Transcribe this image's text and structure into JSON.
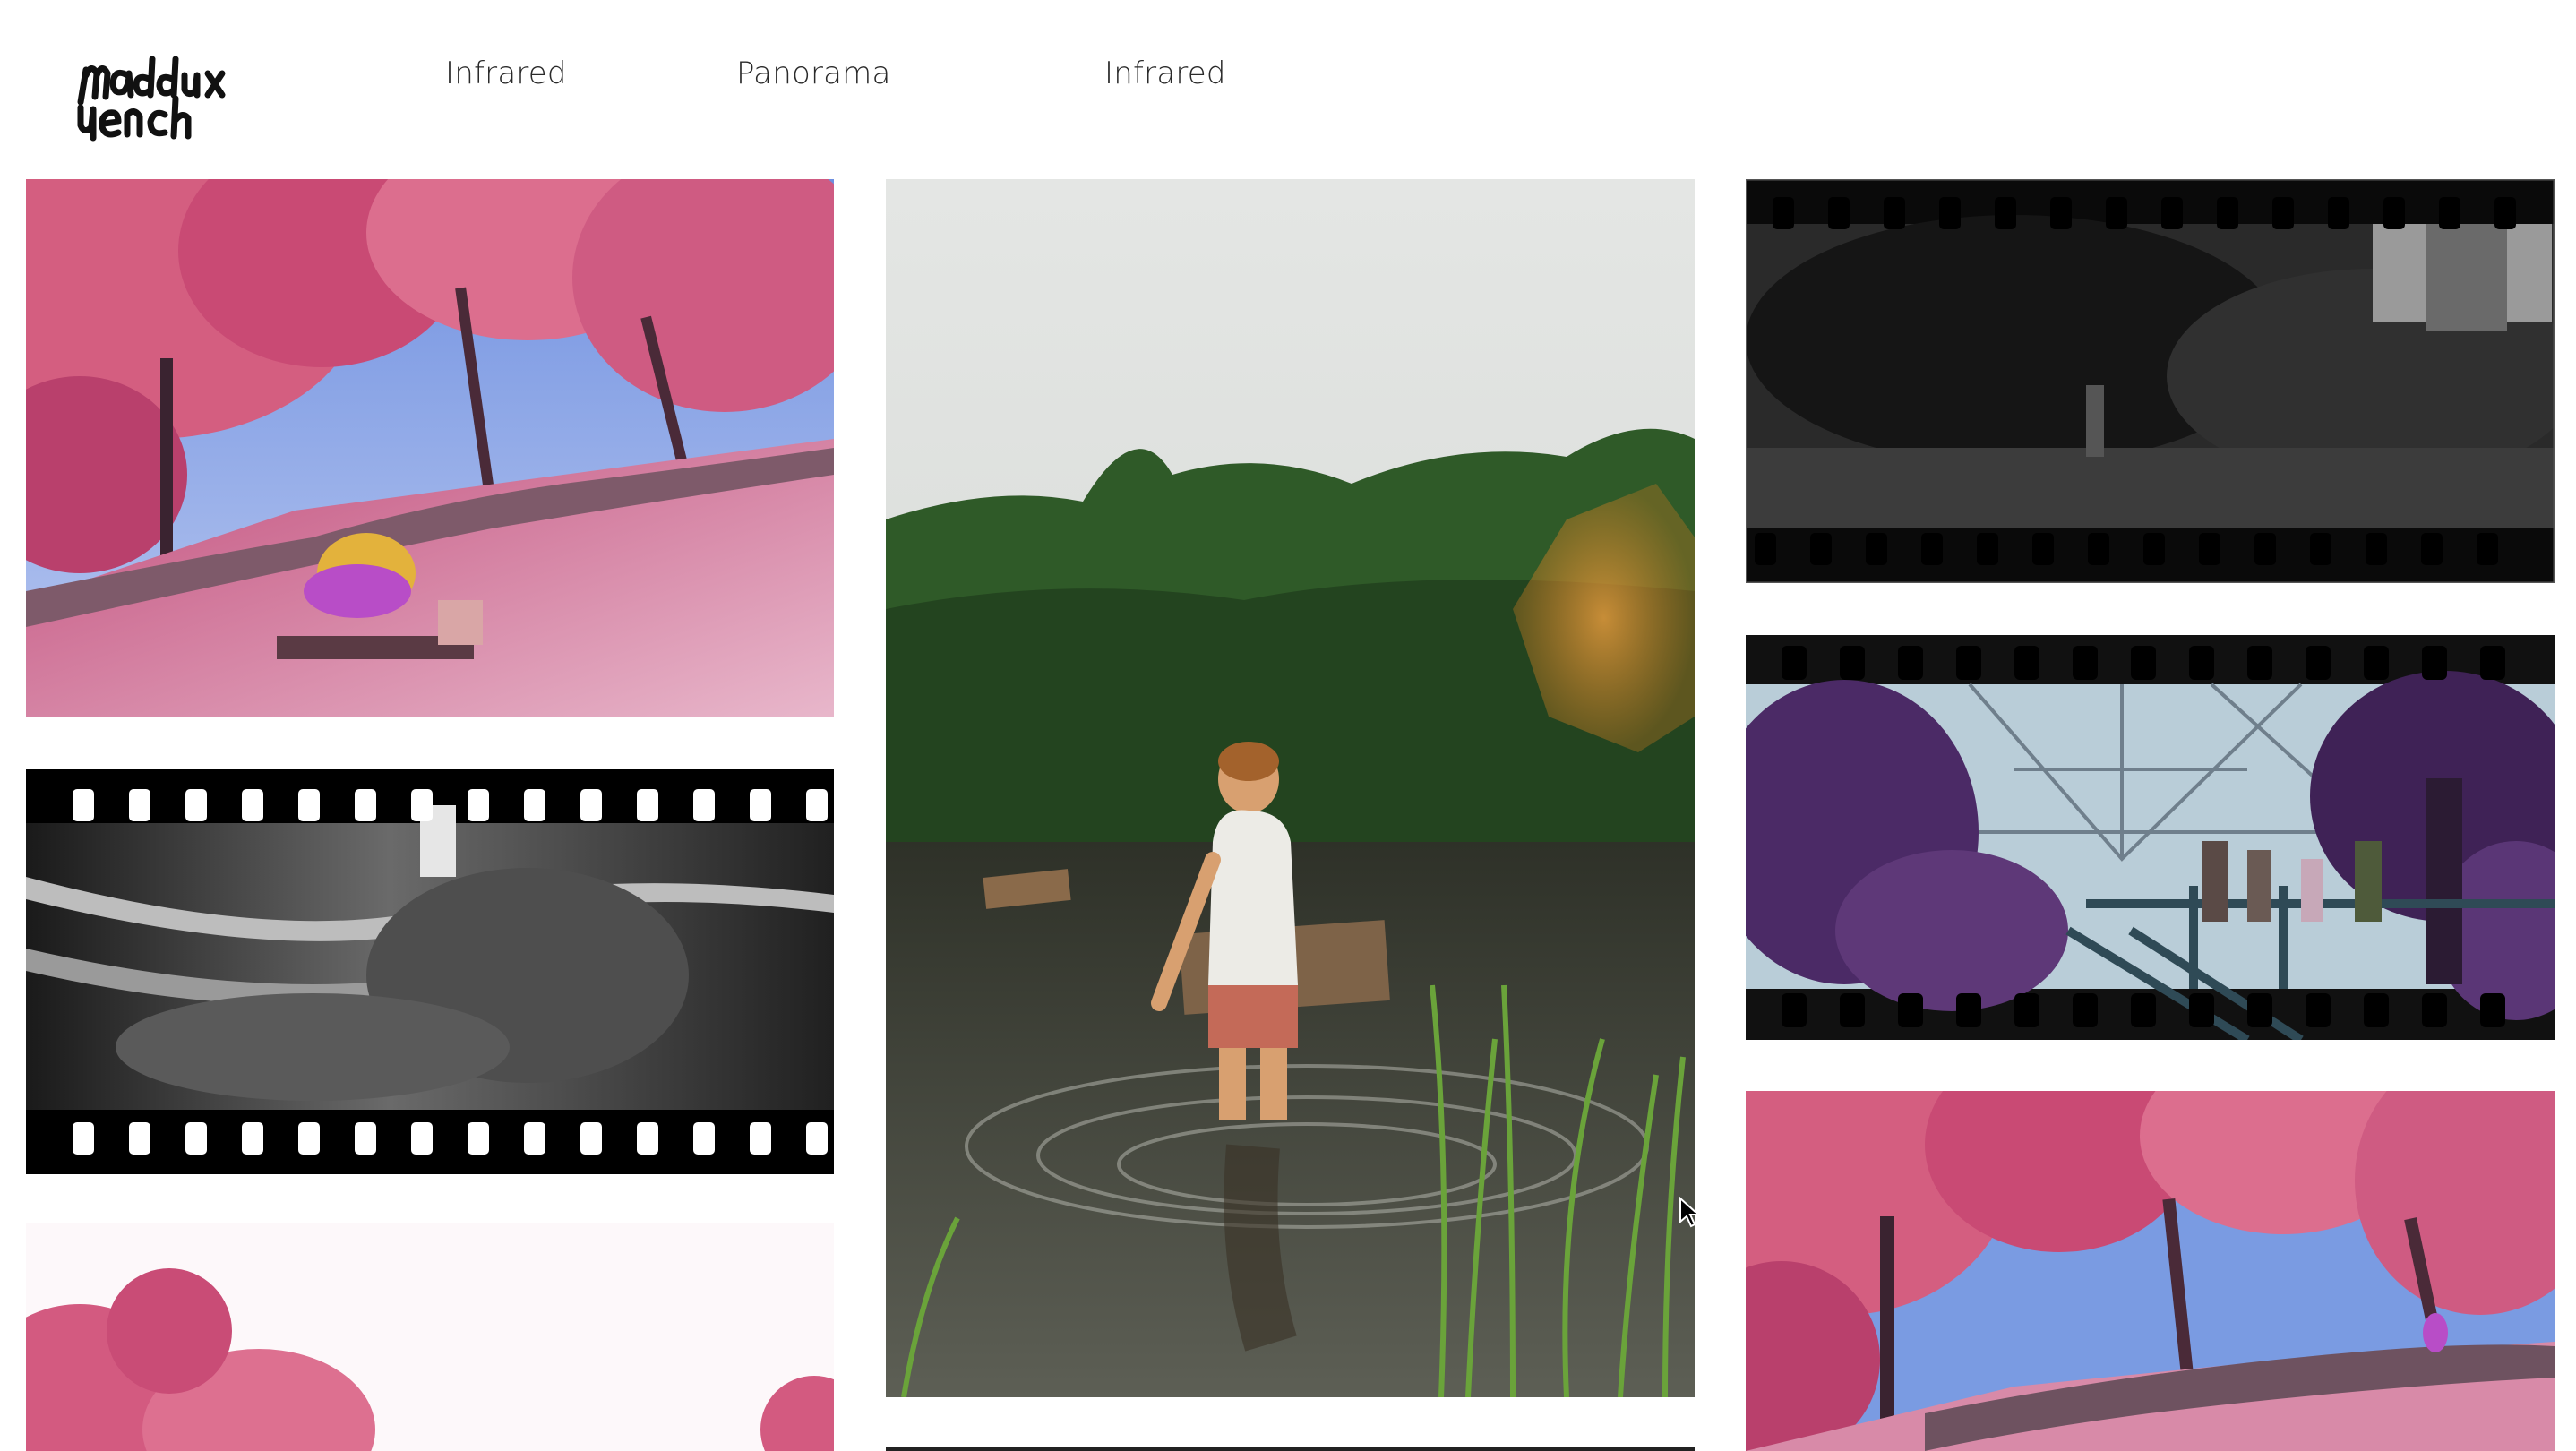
{
  "header": {
    "logo_text_line1": "maddux",
    "logo_text_line2": "uench",
    "nav": [
      {
        "label": "Infrared"
      },
      {
        "label": "Panorama"
      },
      {
        "label": "Infrared"
      }
    ]
  },
  "gallery": {
    "photos": [
      {
        "subject": "infrared-park-bench"
      },
      {
        "subject": "bw-film-strip-hanging-plants"
      },
      {
        "subject": "infrared-treetops"
      },
      {
        "subject": "child-standing-in-lake"
      },
      {
        "subject": "partial-photo-bottom"
      },
      {
        "subject": "bw-film-strip-trees"
      },
      {
        "subject": "infrared-greenhouse-dome-film-strip"
      },
      {
        "subject": "infrared-trees-rocks"
      }
    ]
  },
  "colors": {
    "background": "#ffffff",
    "nav_text": "#2a2a2a",
    "infrared_pink": "#d8607e",
    "sky_blue": "#7fa3e6"
  }
}
